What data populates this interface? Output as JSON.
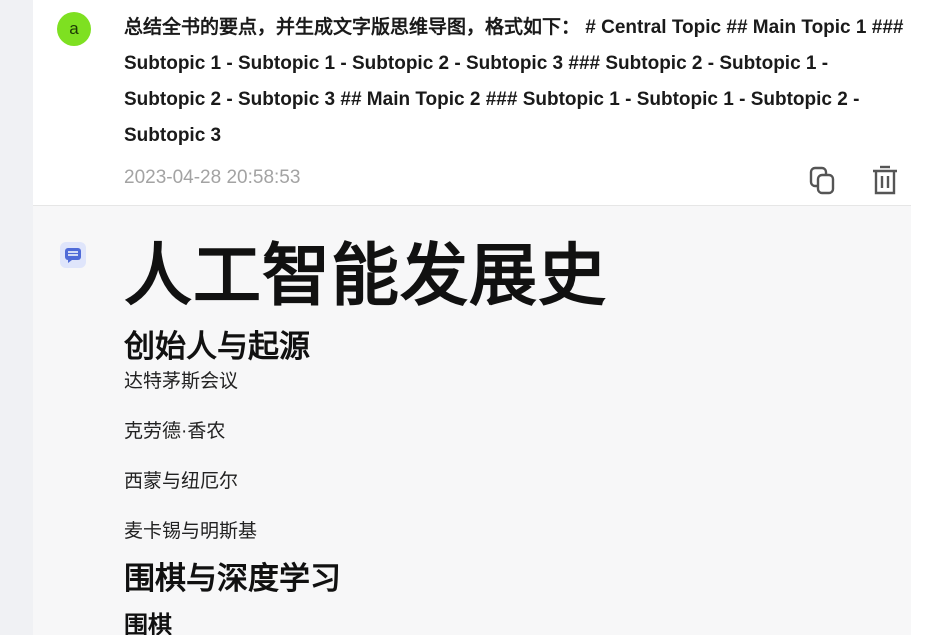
{
  "user_message": {
    "avatar_letter": "a",
    "prompt": "总结全书的要点，并生成文字版思维导图，格式如下： # Central Topic ## Main Topic 1 ### Subtopic 1 - Subtopic 1 - Subtopic 2 - Subtopic 3 ### Subtopic 2 - Subtopic 1 - Subtopic 2 - Subtopic 3 ## Main Topic 2 ### Subtopic 1 - Subtopic 1 - Subtopic 2 - Subtopic 3",
    "timestamp": "2023-04-28 20:58:53",
    "actions": {
      "copy_icon": "copy-icon",
      "delete_icon": "trash-icon"
    }
  },
  "assistant_message": {
    "icon": "chat-bubble-icon",
    "title": "人工智能发展史",
    "section1": {
      "heading": "创始人与起源",
      "items": [
        "达特茅斯会议",
        "克劳德·香农",
        "西蒙与纽厄尔",
        "麦卡锡与明斯基"
      ]
    },
    "section2": {
      "heading": "围棋与深度学习",
      "subheading": "围棋"
    }
  },
  "colors": {
    "avatar_bg": "#7ee021",
    "sidebar_bg": "#f0f1f4",
    "assistant_bg": "#f7f7f8",
    "bot_icon": "#4f6bd8",
    "timestamp": "#a3a3a3"
  }
}
